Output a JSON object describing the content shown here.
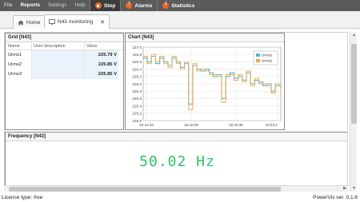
{
  "menu": {
    "file": "File",
    "reports": "Reports",
    "settings": "Settings",
    "help": "Help",
    "stop": "Stop",
    "alarms": "Alarms",
    "statistics": "Statistics"
  },
  "tabs": {
    "home": "Home",
    "monitoring": "N43 monitoring"
  },
  "grid": {
    "title": "Grid [N43]",
    "headers": {
      "name": "Name",
      "description": "User description",
      "value": "Value"
    },
    "rows": [
      {
        "name": "Urms1",
        "description": "",
        "value": "225.79 V"
      },
      {
        "name": "Urms2",
        "description": "",
        "value": "225.85 V"
      },
      {
        "name": "Urms3",
        "description": "",
        "value": "225.85 V"
      }
    ]
  },
  "chart_panel": {
    "title": "Chart [N43]"
  },
  "chart_data": {
    "type": "line",
    "title": "",
    "xlabel": "",
    "ylabel": "",
    "ylim": [
      225.0,
      227.0
    ],
    "yticks": [
      "227.0",
      "226.8",
      "226.6",
      "226.4",
      "226.2",
      "226.0",
      "225.8",
      "225.6",
      "225.4",
      "225.2",
      "225.0"
    ],
    "xticks": [
      "10:41:33",
      "10:42:05",
      "10:42:35",
      "10:43:1"
    ],
    "xlim": [
      0,
      100
    ],
    "grid": true,
    "legend_position": "top-right",
    "series": [
      {
        "name": "Urms1",
        "color": "#49b8d8",
        "x": [
          0,
          3,
          6,
          9,
          12,
          15,
          18,
          21,
          24,
          27,
          30,
          33,
          36,
          39,
          42,
          45,
          48,
          51,
          54,
          57,
          60,
          63,
          66,
          69,
          72,
          75,
          78,
          81,
          84,
          87,
          90,
          93,
          96,
          100
        ],
        "values": [
          226.7,
          226.6,
          226.75,
          226.55,
          226.7,
          226.6,
          226.5,
          226.7,
          226.6,
          226.45,
          226.55,
          225.45,
          226.5,
          226.4,
          226.35,
          226.4,
          226.3,
          226.2,
          226.25,
          225.6,
          226.2,
          226.3,
          226.15,
          226.2,
          226.1,
          226.3,
          226.0,
          226.1,
          226.05,
          225.95,
          226.0,
          225.8,
          225.95,
          225.85
        ]
      },
      {
        "name": "Urms2",
        "color": "#f0a43c",
        "x": [
          0,
          3,
          6,
          9,
          12,
          15,
          18,
          21,
          24,
          27,
          30,
          33,
          36,
          39,
          42,
          45,
          48,
          51,
          54,
          57,
          60,
          63,
          66,
          69,
          72,
          75,
          78,
          81,
          84,
          87,
          90,
          93,
          96,
          100
        ],
        "values": [
          226.75,
          226.55,
          226.8,
          226.6,
          226.75,
          226.55,
          226.45,
          226.75,
          226.55,
          226.4,
          226.6,
          225.3,
          226.55,
          226.35,
          226.4,
          226.35,
          226.25,
          226.25,
          226.2,
          225.5,
          226.25,
          226.25,
          226.1,
          226.25,
          226.05,
          226.35,
          225.95,
          226.15,
          226.0,
          226.0,
          225.95,
          225.75,
          226.0,
          225.8
        ]
      }
    ]
  },
  "frequency": {
    "title": "Frequency [N43]",
    "value": "50.02 Hz"
  },
  "status": {
    "licence_label": "Licence type:",
    "licence_value": "free",
    "version": "PowerVis ver. 0.1.6"
  }
}
